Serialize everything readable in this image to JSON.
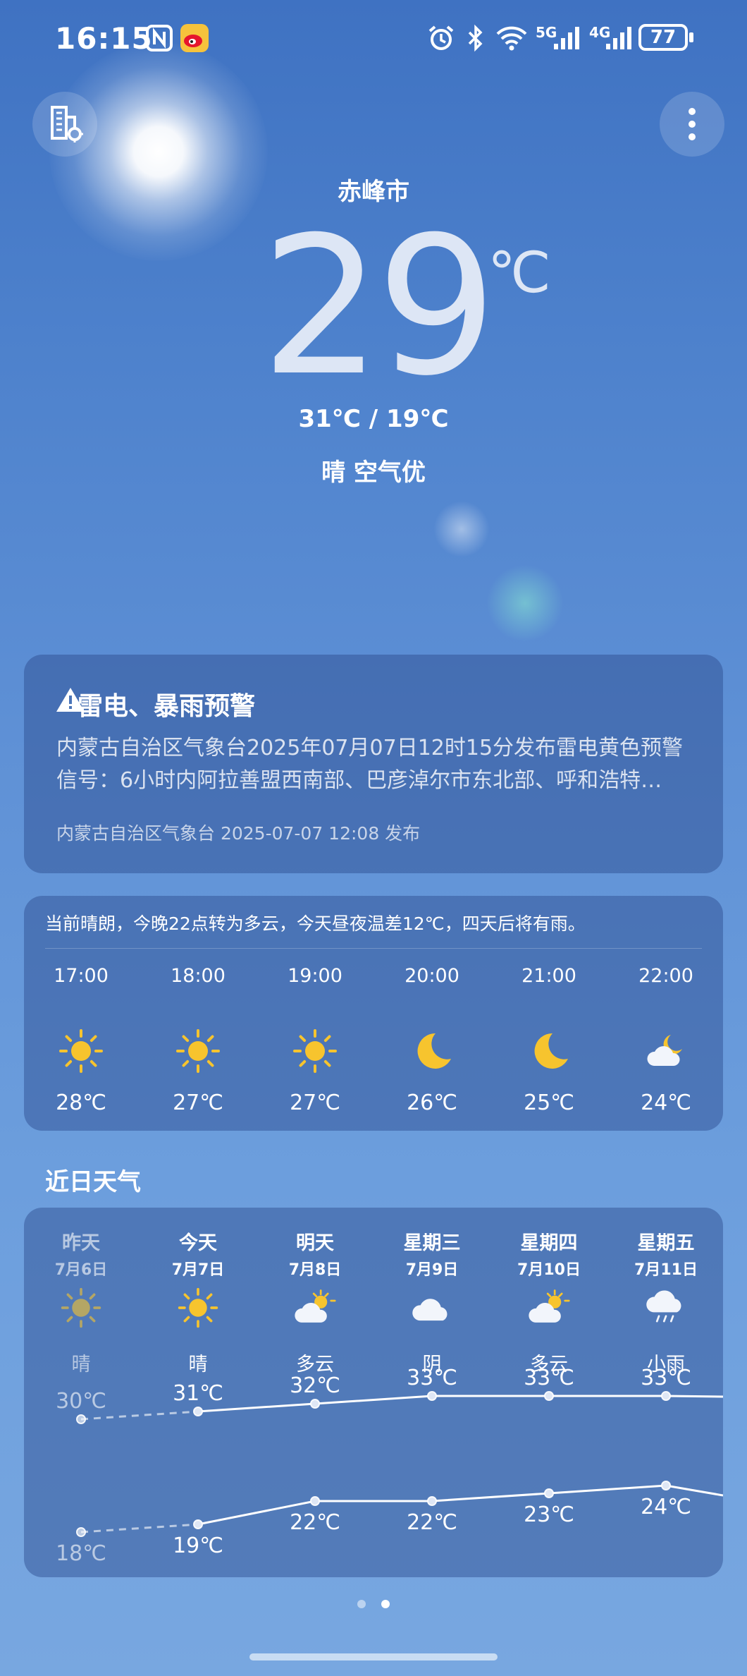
{
  "status_bar": {
    "time": "16:15",
    "network_5g": "5G",
    "network_4g": "4G",
    "battery": "77"
  },
  "location": {
    "city": "赤峰市"
  },
  "current": {
    "temperature": "29",
    "unit": "℃",
    "range": "31℃ / 19℃",
    "condition": "晴 空气优"
  },
  "warning": {
    "title": "雷电、暴雨预警",
    "body_line1": "内蒙古自治区气象台2025年07月07日12时15分发布雷电黄色预警",
    "body_line2": "信号：6小时内阿拉善盟西南部、巴彦淖尔市东北部、呼和浩特…",
    "source": "内蒙古自治区气象台 2025-07-07 12:08 发布"
  },
  "hourly": {
    "summary": "当前晴朗，今晚22点转为多云，今天昼夜温差12℃，四天后将有雨。",
    "items": [
      {
        "time": "17:00",
        "icon": "sun-icon",
        "temp": "28℃"
      },
      {
        "time": "18:00",
        "icon": "sun-icon",
        "temp": "27℃"
      },
      {
        "time": "19:00",
        "icon": "sun-icon",
        "temp": "27℃"
      },
      {
        "time": "20:00",
        "icon": "moon-icon",
        "temp": "26℃"
      },
      {
        "time": "21:00",
        "icon": "moon-icon",
        "temp": "25℃"
      },
      {
        "time": "22:00",
        "icon": "cloudy-night-icon",
        "temp": "24℃"
      }
    ]
  },
  "daily": {
    "title": "近日天气",
    "items": [
      {
        "day": "昨天",
        "date": "7月6日",
        "icon": "sun-icon",
        "cond": "晴",
        "high": "30℃",
        "low": "18℃"
      },
      {
        "day": "今天",
        "date": "7月7日",
        "icon": "sun-icon",
        "cond": "晴",
        "high": "31℃",
        "low": "19℃"
      },
      {
        "day": "明天",
        "date": "7月8日",
        "icon": "partly-cloudy-icon",
        "cond": "多云",
        "high": "32℃",
        "low": "22℃"
      },
      {
        "day": "星期三",
        "date": "7月9日",
        "icon": "cloud-icon",
        "cond": "阴",
        "high": "33℃",
        "low": "22℃"
      },
      {
        "day": "星期四",
        "date": "7月10日",
        "icon": "partly-cloudy-icon",
        "cond": "多云",
        "high": "33℃",
        "low": "23℃"
      },
      {
        "day": "星期五",
        "date": "7月11日",
        "icon": "rain-icon",
        "cond": "小雨",
        "high": "33℃",
        "low": "24℃"
      }
    ]
  },
  "pager": {
    "count": 2,
    "active": 2
  }
}
